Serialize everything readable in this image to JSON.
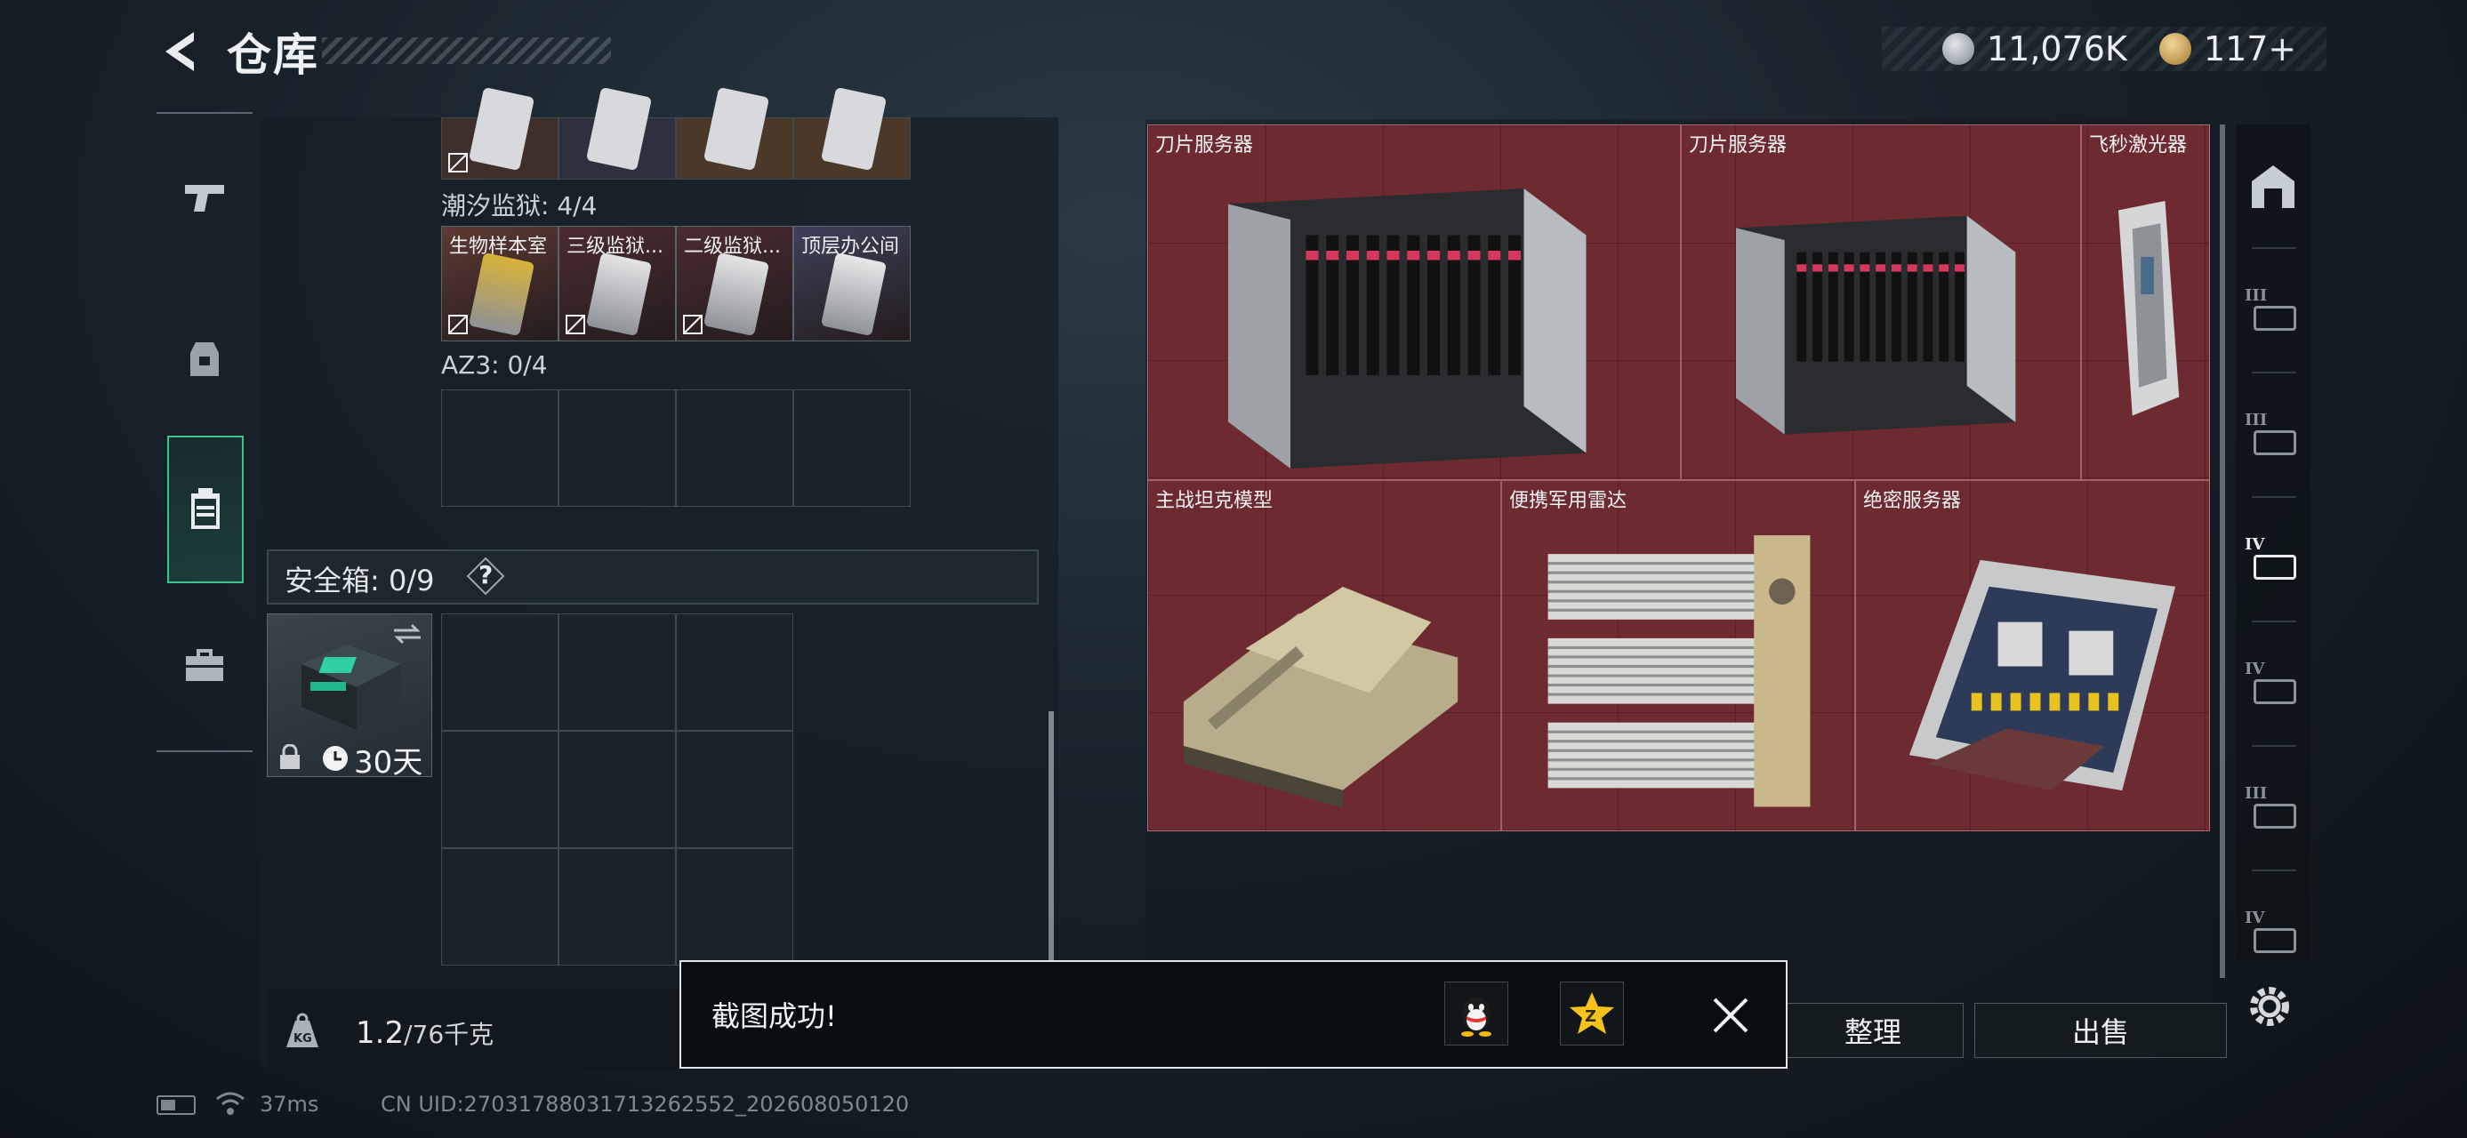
{
  "header": {
    "title": "仓库"
  },
  "currency": {
    "silver": "11,076K",
    "gold": "117+"
  },
  "left_panel": {
    "prison_label": "潮汐监狱: 4/4",
    "prison_cards": [
      {
        "name": "生物样本室",
        "bg": "#5e3a33",
        "item": "#d8b33a"
      },
      {
        "name": "三级监狱...",
        "bg": "#4a2c30",
        "item": "#e4e4e6"
      },
      {
        "name": "二级监狱...",
        "bg": "#4a2c30",
        "item": "#e4e4e6"
      },
      {
        "name": "顶层办公间",
        "bg": "#3d4158",
        "item": "#e8e8ea"
      }
    ],
    "az3_label": "AZ3: 0/4",
    "safebox_label": "安全箱:  0/9",
    "safebox_help": "?",
    "safebox_days": "30天",
    "weight_value": "1.2",
    "weight_unit": "/76千克"
  },
  "stash_items": [
    {
      "name": "刀片服务器",
      "kind": "server"
    },
    {
      "name": "刀片服务器",
      "kind": "server"
    },
    {
      "name": "飞秒激光器",
      "kind": "laser"
    },
    {
      "name": "主战坦克模型",
      "kind": "tank"
    },
    {
      "name": "便携军用雷达",
      "kind": "radar"
    },
    {
      "name": "绝密服务器",
      "kind": "board"
    }
  ],
  "buttons": {
    "sort": "整理",
    "sell": "出售"
  },
  "right_nav": {
    "tier_labels": [
      "III",
      "III",
      "IV",
      "IV",
      "III",
      "IV"
    ]
  },
  "toast": {
    "text": "截图成功!"
  },
  "status": {
    "ping": "37ms",
    "uid": "CN UID:2703178803171326255 2_202608050120",
    "uid_full": "CN UID:27031788031713262552_202608050120"
  },
  "colors": {
    "accent": "#39c48b",
    "stash_bg": "#6e2a31",
    "toast_bg": "#0a0d10"
  }
}
